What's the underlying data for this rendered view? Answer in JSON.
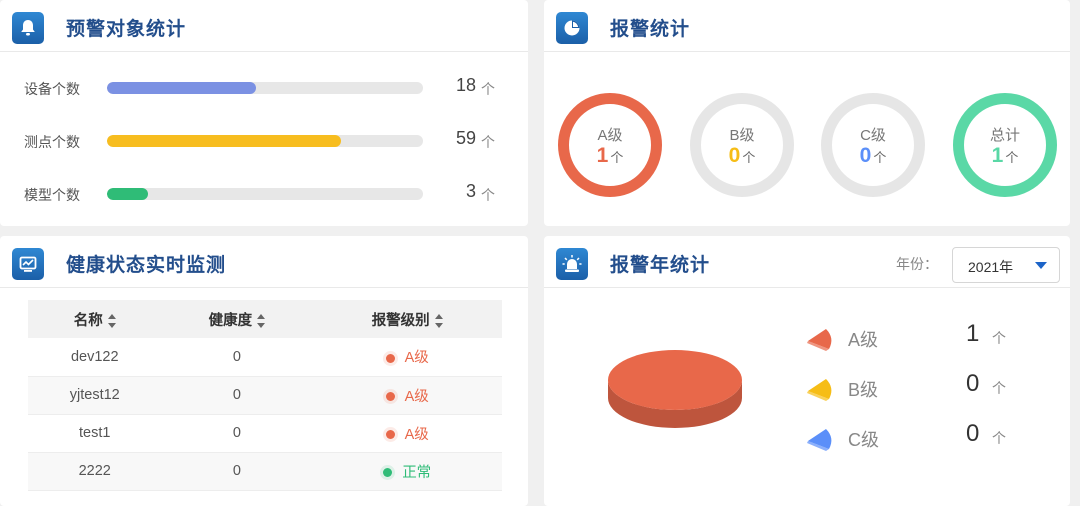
{
  "warning_objects": {
    "title": "预警对象统计",
    "items": [
      {
        "label": "设备个数",
        "value": "18",
        "unit": "个",
        "fill_percent": 47,
        "color": "#7b91e3"
      },
      {
        "label": "测点个数",
        "value": "59",
        "unit": "个",
        "fill_percent": 74,
        "color": "#f7bd1f"
      },
      {
        "label": "模型个数",
        "value": "3",
        "unit": "个",
        "fill_percent": 13,
        "color": "#2fbc77"
      }
    ]
  },
  "alarm_stats": {
    "title": "报警统计",
    "rings": [
      {
        "label": "A级",
        "value": "1",
        "unit": "个",
        "color": "#e8684a",
        "active": true
      },
      {
        "label": "B级",
        "value": "0",
        "unit": "个",
        "color": "#f6bd16",
        "active": false
      },
      {
        "label": "C级",
        "value": "0",
        "unit": "个",
        "color": "#5b8ff9",
        "active": false
      },
      {
        "label": "总计",
        "value": "1",
        "unit": "个",
        "color": "#5ad8a6",
        "active": true
      }
    ]
  },
  "health_monitor": {
    "title": "健康状态实时监测",
    "columns": [
      "名称",
      "健康度",
      "报警级别"
    ],
    "rows": [
      {
        "name": "dev122",
        "health": "0",
        "level": "A级",
        "level_color": "#e8684a"
      },
      {
        "name": "yjtest12",
        "health": "0",
        "level": "A级",
        "level_color": "#e8684a"
      },
      {
        "name": "test1",
        "health": "0",
        "level": "A级",
        "level_color": "#e8684a"
      },
      {
        "name": "2222",
        "health": "0",
        "level": "正常",
        "level_color": "#2fbc77"
      }
    ]
  },
  "yearly_alarm": {
    "title": "报警年统计",
    "year_label": "年份：",
    "year_value": "2021年",
    "legend": [
      {
        "label": "A级",
        "value": "1",
        "unit": "个",
        "color": "#e8684a"
      },
      {
        "label": "B级",
        "value": "0",
        "unit": "个",
        "color": "#f6bd16"
      },
      {
        "label": "C级",
        "value": "0",
        "unit": "个",
        "color": "#5b8ff9"
      }
    ]
  },
  "chart_data": {
    "type": "pie",
    "categories": [
      "A级",
      "B级",
      "C级"
    ],
    "values": [
      1,
      0,
      0
    ],
    "colors": [
      "#e8684a",
      "#f6bd16",
      "#5b8ff9"
    ],
    "title": ""
  }
}
